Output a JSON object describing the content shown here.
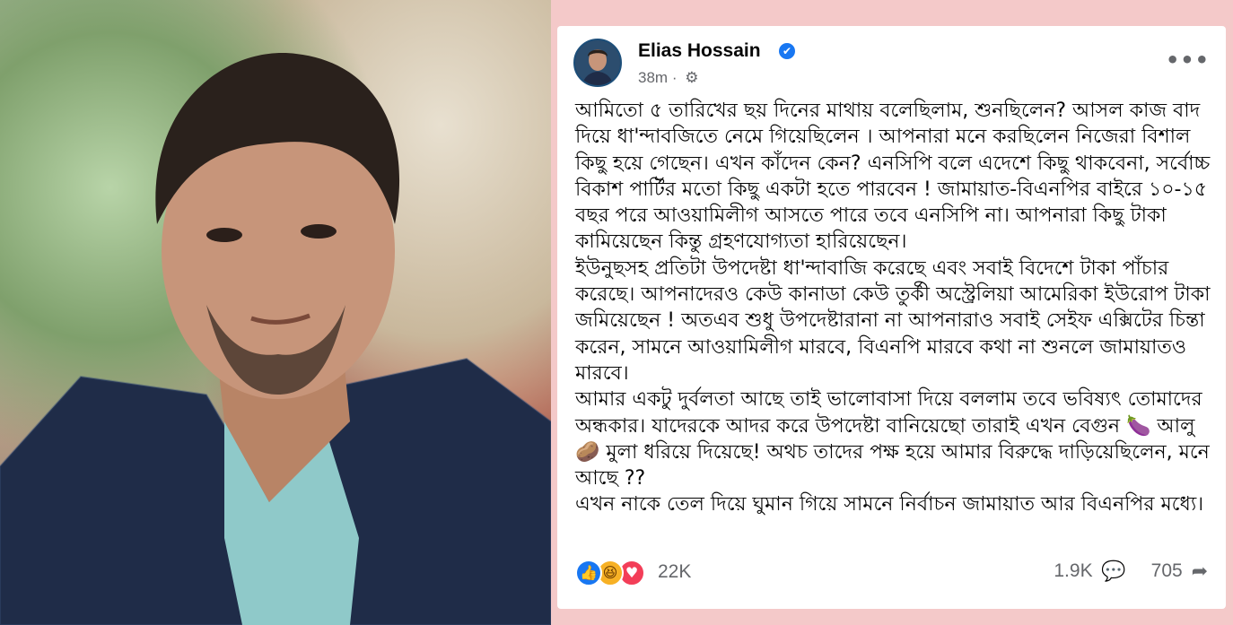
{
  "photo": {
    "icon": "portrait-photo"
  },
  "post": {
    "author": "Elias Hossain",
    "verified_icon": "✔",
    "time": "38m",
    "separator": "·",
    "audience_icon": "⚙",
    "more_icon": "•••",
    "paragraphs": [
      "আমিতো ৫ তারিখের ছয় দিনের মাথায় বলেছিলাম, শুনছিলেন? আসল কাজ বাদ দিয়ে ধা'ন্দাবজিতে নেমে গিয়েছিলেন । আপনারা মনে করছিলেন নিজেরা বিশাল কিছু হয়ে গেছেন। এখন কাঁদেন কেন? এনসিপি বলে এদেশে কিছু থাকবেনা, সর্বোচ্চ বিকাশ পার্টির মতো কিছু একটা হতে পারবেন ! জামায়াত-বিএনপির বাইরে ১০-১৫ বছর পরে আওয়ামিলীগ আসতে পারে তবে এনসিপি না। আপনারা কিছু টাকা কামিয়েছেন কিন্তু গ্রহণযোগ্যতা হারিয়েছেন।",
      "ইউনুছসহ প্রতিটা উপদেষ্টা ধা'ন্দাবাজি করেছে এবং সবাই বিদেশে টাকা পাঁচার করেছে। আপনাদেরও কেউ কানাডা কেউ তুর্কী অস্ট্রেলিয়া আমেরিকা ইউরোপ টাকা জমিয়েছেন ! অতএব শুধু উপদেষ্টারানা না আপনারাও সবাই সেইফ এক্সিটের চিন্তা করেন, সামনে আওয়ামিলীগ মারবে, বিএনপি মারবে কথা না শুনলে জামায়াতও মারবে।",
      "আমার একটু দুর্বলতা আছে তাই ভালোবাসা দিয়ে বললাম তবে ভবিষ্যৎ তোমাদের অন্ধকার। যাদেরকে আদর করে উপদেষ্টা বানিয়েছো তারাই এখন বেগুন 🍆 আলু 🥔 মুলা ধরিয়ে দিয়েছে! অথচ তাদের পক্ষ হয়ে আমার বিরুদ্ধে দাড়িয়েছিলেন, মনে আছে ??",
      "এখন নাকে তেল দিয়ে ঘুমান গিয়ে সামনে নির্বাচন জামায়াত আর বিএনপির মধ্যে।"
    ],
    "reactions": {
      "like_icon": "👍",
      "haha_icon": "😆",
      "love_icon": "♥",
      "count": "22K"
    },
    "comments": {
      "count": "1.9K",
      "icon": "💬"
    },
    "shares": {
      "count": "705",
      "icon": "➦"
    }
  }
}
